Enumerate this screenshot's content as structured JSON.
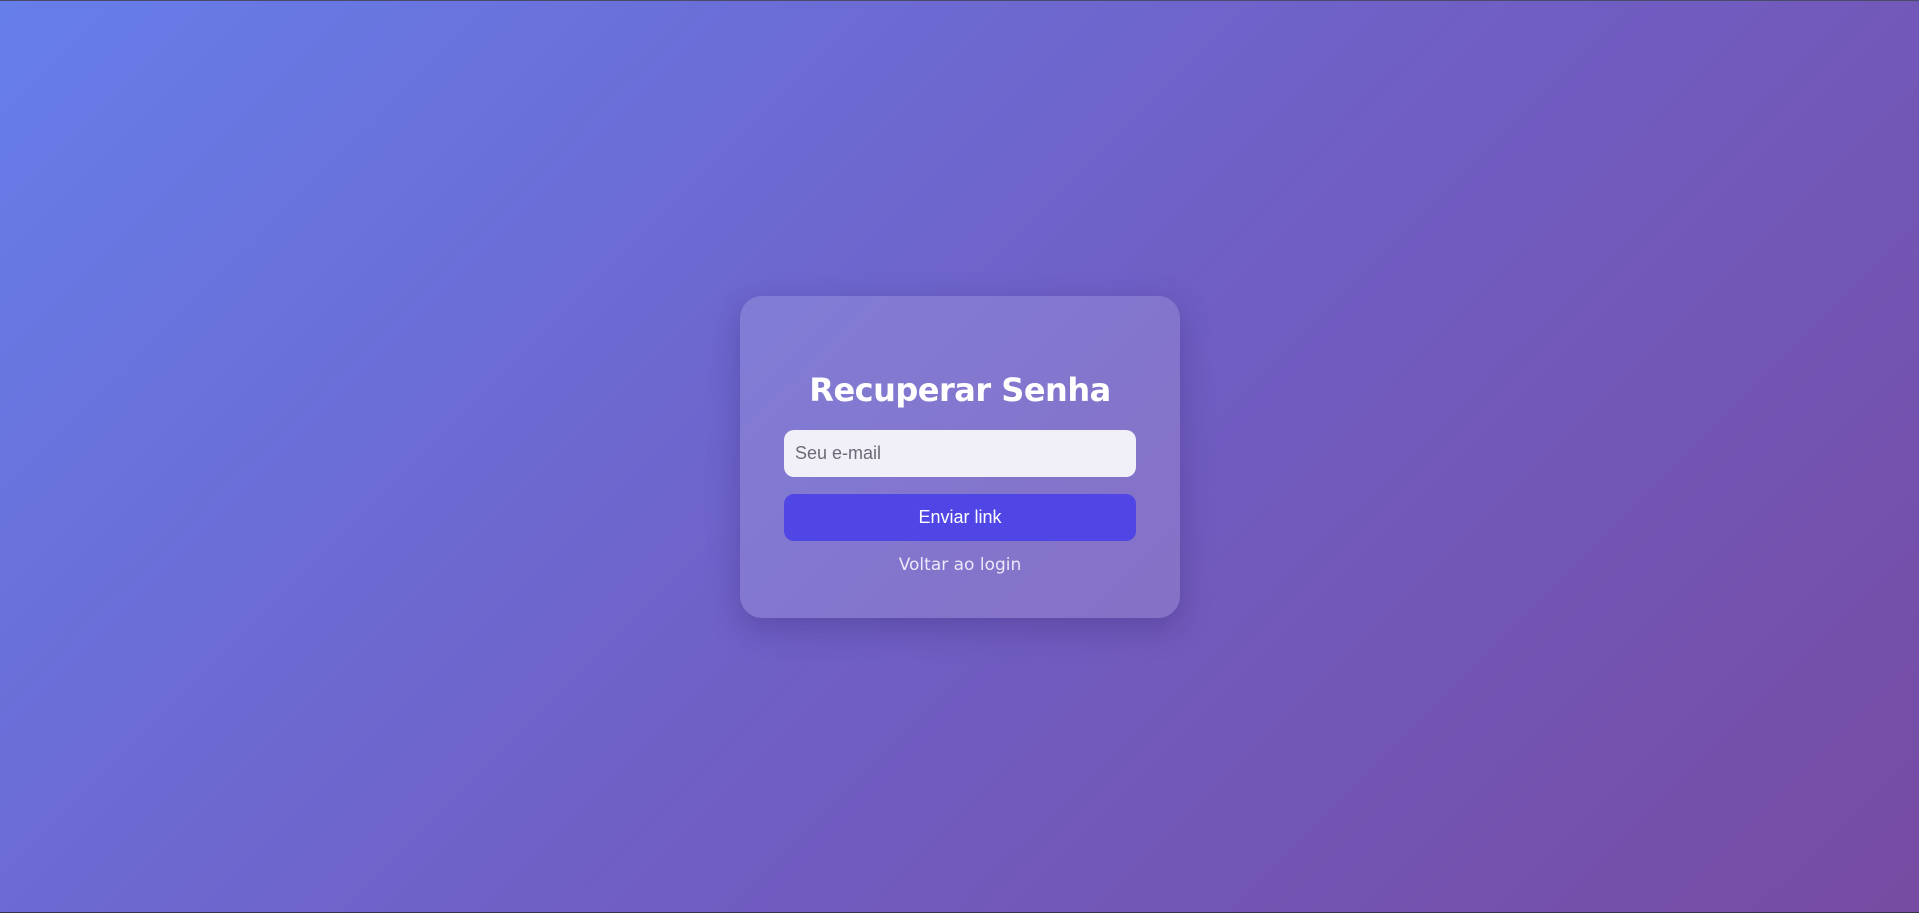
{
  "recover_form": {
    "title": "Recuperar Senha",
    "email": {
      "placeholder": "Seu e-mail",
      "value": ""
    },
    "submit_label": "Enviar link",
    "back_link_label": "Voltar ao login"
  },
  "colors": {
    "background_start": "#667eea",
    "background_end": "#764ba2",
    "button": "#4f46e5",
    "input_background": "#f1eff8"
  }
}
